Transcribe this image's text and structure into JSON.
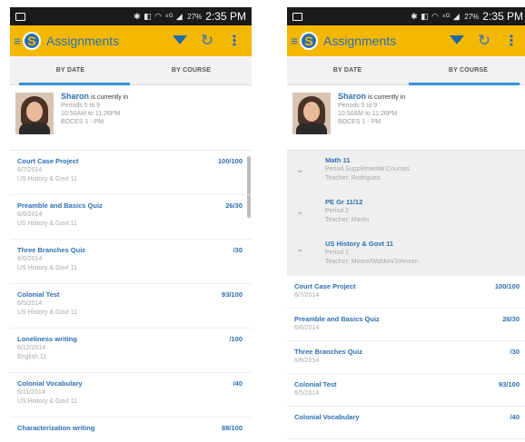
{
  "status_bar": {
    "time": "2:35 PM",
    "battery": "27%",
    "icons": "✱ ◧ ◠ ⁴ᴳ ◢"
  },
  "app": {
    "title": "Assignments",
    "logo_letter": "S"
  },
  "tabs": {
    "by_date": "BY DATE",
    "by_course": "BY COURSE"
  },
  "profile": {
    "name": "Sharon",
    "status": "is currently in",
    "periods": "Periods 5 to 9",
    "time": "10:50AM to 11:26PM",
    "location": "BOCES 1 - PM"
  },
  "screen1": {
    "assignments": [
      {
        "title": "Court Case Project",
        "score": "100/100",
        "date": "6/7/2014",
        "course": "US History & Govt 11"
      },
      {
        "title": "Preamble and Basics Quiz",
        "score": "26/30",
        "date": "6/6/2014",
        "course": "US History & Govt 11"
      },
      {
        "title": "Three Branches Quiz",
        "score": "/30",
        "date": "6/6/2014",
        "course": "US History & Govt 11"
      },
      {
        "title": "Colonial Test",
        "score": "93/100",
        "date": "6/5/2014",
        "course": "US History & Govt 11"
      },
      {
        "title": "Loneliness writing",
        "score": "/100",
        "date": "6/12/2014",
        "course": "English 11"
      },
      {
        "title": "Colonial Vocabulary",
        "score": "/40",
        "date": "6/11/2014",
        "course": "US History & Govt 11"
      },
      {
        "title": "Characterization writing",
        "score": "88/100",
        "date": "",
        "course": ""
      }
    ]
  },
  "screen2": {
    "courses": [
      {
        "title": "Math 11",
        "period": "Period Supplemental Courses",
        "teacher": "Teacher: Rodriguez",
        "expanded": false
      },
      {
        "title": "PE Gr 11/12",
        "period": "Period 2",
        "teacher": "Teacher: Martin",
        "expanded": false
      },
      {
        "title": "US History & Govt 11",
        "period": "Period 1",
        "teacher": "Teacher: Moore/Waldon/Johnson",
        "expanded": true
      }
    ],
    "assignments": [
      {
        "title": "Court Case Project",
        "score": "100/100",
        "date": "6/7/2014"
      },
      {
        "title": "Preamble and Basics Quiz",
        "score": "26/30",
        "date": "6/6/2014"
      },
      {
        "title": "Three Branches Quiz",
        "score": "/30",
        "date": "6/6/2014"
      },
      {
        "title": "Colonial Test",
        "score": "93/100",
        "date": "6/5/2014"
      },
      {
        "title": "Colonial Vocabulary",
        "score": "/40",
        "date": ""
      }
    ]
  },
  "icons": {
    "menu": "≡",
    "filter": "filter-icon",
    "refresh": "↻",
    "more": "⋮",
    "chevron_down": "⌄",
    "chevron_up": "⌃"
  },
  "colors": {
    "accent": "#f5b800",
    "brand_blue": "#2b6fb0",
    "tab_indicator": "#3b8fd6"
  }
}
